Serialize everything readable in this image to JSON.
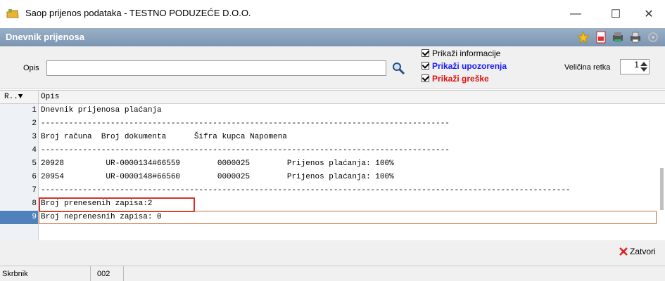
{
  "window": {
    "title": "Saop prijenos podataka - TESTNO PODUZEĆE D.O.O.",
    "minimize": "—",
    "maximize": "☐",
    "close": "✕"
  },
  "header": {
    "title": "Dnevnik prijenosa"
  },
  "toolbar": {
    "icons": [
      "star-icon",
      "pdf-icon",
      "export-icon",
      "print-icon",
      "settings-icon"
    ]
  },
  "filter": {
    "opis_label": "Opis",
    "opis_value": "",
    "checkboxes": [
      {
        "label": "Prikaži informacije",
        "checked": true,
        "color": "#000000"
      },
      {
        "label": "Prikaži upozorenja",
        "checked": true,
        "color": "#1a1aff"
      },
      {
        "label": "Prikaži greške",
        "checked": true,
        "color": "#e01010"
      }
    ],
    "row_size_label": "Veličina retka",
    "row_size_value": "1"
  },
  "grid": {
    "columns": [
      "R..▼",
      "Opis"
    ],
    "rows": [
      {
        "n": "1",
        "text": "Dnevnik prijenosa plaćanja"
      },
      {
        "n": "2",
        "text": "----------------------------------------------------------------------------------------"
      },
      {
        "n": "3",
        "text": "Broj računa  Broj dokumenta      Šifra kupca Napomena"
      },
      {
        "n": "4",
        "text": "----------------------------------------------------------------------------------------"
      },
      {
        "n": "5",
        "text": "20928         UR-0000134#66559        0000025        Prijenos plaćanja: 100%"
      },
      {
        "n": "6",
        "text": "20954         UR-0000148#66560        0000025        Prijenos plaćanja: 100%"
      },
      {
        "n": "7",
        "text": "------------------------------------------------------------------------------------------------------------------"
      },
      {
        "n": "8",
        "text": "Broj prenesenih zapisa:2"
      },
      {
        "n": "9",
        "text": "Broj neprenesnih zapisa: 0"
      }
    ]
  },
  "actions": {
    "close_label": "Zatvori"
  },
  "status": {
    "user": "Skrbnik",
    "code": "002"
  }
}
